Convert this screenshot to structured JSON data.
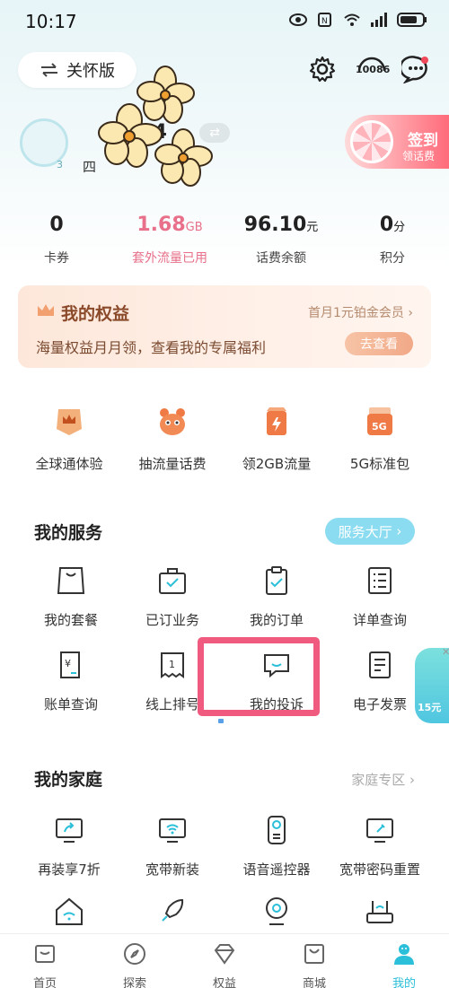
{
  "status_bar": {
    "time": "10:17"
  },
  "header": {
    "care_mode_label": "关怀版",
    "service_hotline": "10086"
  },
  "profile": {
    "phone_suffix": "294",
    "level": "3",
    "location_prefix": "四",
    "checkin": {
      "title": "签到",
      "subtitle": "领话费"
    }
  },
  "stats": [
    {
      "value": "0",
      "unit": "",
      "label": "卡券"
    },
    {
      "value": "1.68",
      "unit": "GB",
      "label": "套外流量已用"
    },
    {
      "value": "96.10",
      "unit": "元",
      "label": "话费余额"
    },
    {
      "value": "0",
      "unit": "分",
      "label": "积分"
    }
  ],
  "benefits": {
    "title": "我的权益",
    "promo": "首月1元铂金会员",
    "desc": "海量权益月月领，查看我的专属福利",
    "button": "去查看"
  },
  "quick_icons": [
    {
      "label": "全球通体验",
      "icon": "crown-badge-icon"
    },
    {
      "label": "抽流量话费",
      "icon": "mascot-icon"
    },
    {
      "label": "领2GB流量",
      "icon": "data-pack-icon"
    },
    {
      "label": "5G标准包",
      "icon": "5g-pack-icon"
    }
  ],
  "my_services": {
    "title": "我的服务",
    "hall_button": "服务大厅",
    "items": [
      {
        "label": "我的套餐",
        "icon": "bag-icon"
      },
      {
        "label": "已订业务",
        "icon": "briefcase-icon"
      },
      {
        "label": "我的订单",
        "icon": "clipboard-icon"
      },
      {
        "label": "详单查询",
        "icon": "list-icon"
      },
      {
        "label": "账单查询",
        "icon": "bill-icon"
      },
      {
        "label": "线上排号",
        "icon": "queue-ticket-icon"
      },
      {
        "label": "我的投诉",
        "icon": "complaint-icon"
      },
      {
        "label": "电子发票",
        "icon": "invoice-icon"
      }
    ]
  },
  "my_family": {
    "title": "我的家庭",
    "zone_link": "家庭专区",
    "items": [
      {
        "label": "再装享7折",
        "icon": "tv-share-icon"
      },
      {
        "label": "宽带新装",
        "icon": "wifi-tv-icon"
      },
      {
        "label": "语音遥控器",
        "icon": "remote-icon"
      },
      {
        "label": "宽带密码重置",
        "icon": "key-tv-icon"
      }
    ]
  },
  "float_ad": {
    "text": "15元"
  },
  "tabbar": [
    {
      "label": "首页",
      "icon": "home-icon",
      "active": false
    },
    {
      "label": "探索",
      "icon": "compass-icon",
      "active": false
    },
    {
      "label": "权益",
      "icon": "diamond-icon",
      "active": false
    },
    {
      "label": "商城",
      "icon": "shopping-bag-icon",
      "active": false
    },
    {
      "label": "我的",
      "icon": "user-icon",
      "active": true
    }
  ],
  "colors": {
    "accent": "#2bbfd9",
    "highlight_box": "#ef5a7e",
    "pink_stat": "#e8708a"
  }
}
